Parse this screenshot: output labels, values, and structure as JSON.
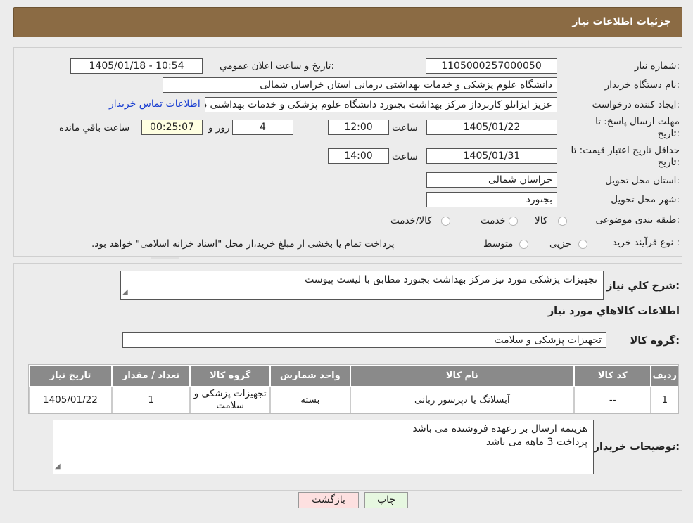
{
  "header": {
    "title": "جزئیات اطلاعات نیاز"
  },
  "labels": {
    "need_number": "شماره نیاز:",
    "announce_datetime": "تاریخ و ساعت اعلان عمومي:",
    "buyer_org": "نام دستگاه خریدار:",
    "requester": "ایجاد کننده درخواست:",
    "deadline": "مهلت ارسال پاسخ: تا تاریخ:",
    "time": "ساعت",
    "days_and": "روز و",
    "remaining": "ساعت باقي مانده",
    "price_validity": "حداقل تاریخ اعتبار قیمت: تا تاریخ:",
    "province": "استان محل تحویل:",
    "city": "شهر محل تحویل:",
    "category": "طبقه بندی موضوعی:",
    "process_type": "نوع فرآیند خرید :",
    "description": "شرح کلي نیاز:",
    "goods_info": "اطلاعات کالاهاي مورد نیاز",
    "goods_group": "گروه کالا:",
    "buyer_notes": "توضیحات خریدار:"
  },
  "form": {
    "need_number": "1105000257000050",
    "announce_datetime": "1405/01/18 - 10:54",
    "buyer_org": "دانشگاه علوم پزشکی و خدمات بهداشتی درمانی استان خراسان شمالی",
    "requester": "عزیز ایزانلو کاربرداز مرکز بهداشت بجنورد دانشگاه علوم پزشکی و خدمات بهداشتی درمانی استان خراسان شمالی",
    "contact_link": "اطلاعات تماس خریدار",
    "deadline_date": "1405/01/22",
    "deadline_time": "12:00",
    "days": "4",
    "remaining_time": "00:25:07",
    "validity_date": "1405/01/31",
    "validity_time": "14:00",
    "province": "خراسان شمالی",
    "city": "بجنورد"
  },
  "category_options": [
    "کالا",
    "خدمت",
    "کالا/خدمت"
  ],
  "process_options": [
    "جزیی",
    "متوسط"
  ],
  "process_note": "پرداخت تمام یا بخشی از مبلغ خرید،از محل \"اسناد خزانه اسلامی\" خواهد بود.",
  "description_text": "تجهیزات پزشکی مورد نیز مرکز بهداشت بجنورد مطابق با لیست پیوست",
  "goods_group_value": "تجهیزات پزشکی و سلامت",
  "table": {
    "headers": [
      "ردیف",
      "کد کالا",
      "نام کالا",
      "واحد شمارش",
      "گروه کالا",
      "تعداد / مقدار",
      "تاریخ نیاز"
    ],
    "rows": [
      [
        "1",
        "--",
        "آبسلانگ یا دپرسور زبانی",
        "بسته",
        "تجهیزات پزشکی و سلامت",
        "1",
        "1405/01/22"
      ]
    ]
  },
  "buyer_notes_lines": [
    "هزینمه ارسال بر رعهده فروشنده می باشد",
    "پرداخت 3 ماهه می باشد"
  ],
  "buttons": {
    "print": "چاپ",
    "back": "بازگشت"
  },
  "watermark": "AriaTender.neT",
  "colors": {
    "header": "#8b6b44",
    "link": "#1a3fd1",
    "back_button": "#fde0e0",
    "print_button": "#e6f7e0"
  }
}
